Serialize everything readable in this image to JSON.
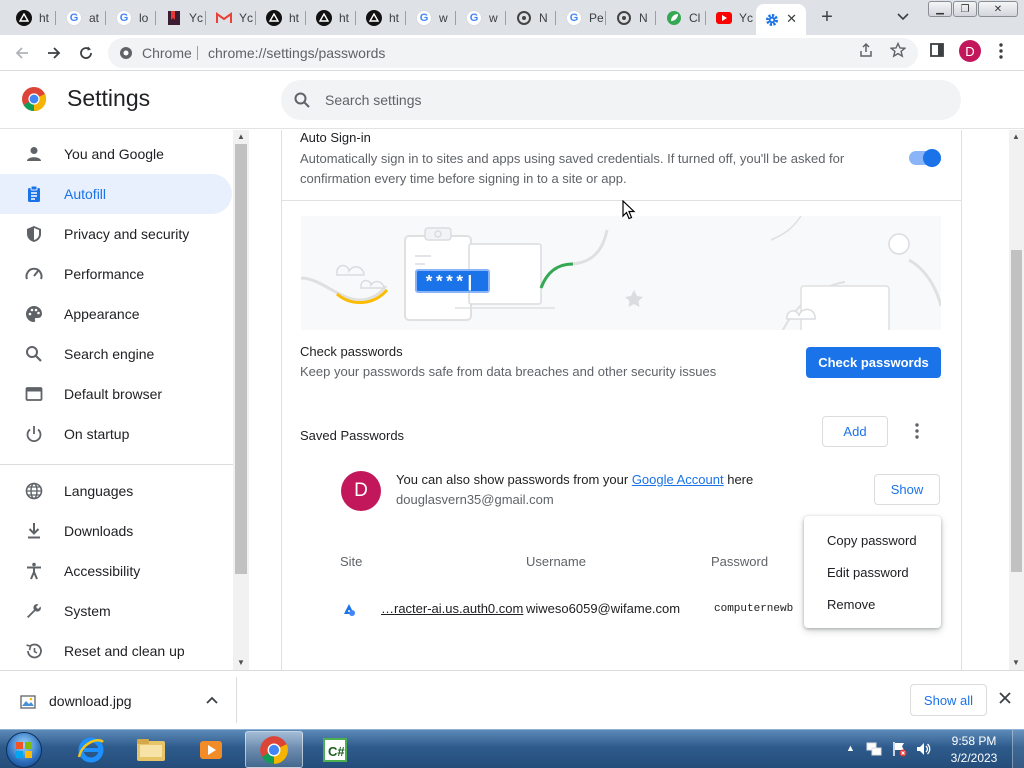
{
  "browser": {
    "tabs": [
      {
        "title": "ht",
        "icon": "github-icon"
      },
      {
        "title": "at",
        "icon": "google-icon"
      },
      {
        "title": "lo",
        "icon": "google-icon"
      },
      {
        "title": "Yc",
        "icon": "bookmark-icon"
      },
      {
        "title": "Yc",
        "icon": "gmail-icon"
      },
      {
        "title": "ht",
        "icon": "github-icon"
      },
      {
        "title": "ht",
        "icon": "github-icon"
      },
      {
        "title": "ht",
        "icon": "github-icon"
      },
      {
        "title": "w",
        "icon": "google-icon"
      },
      {
        "title": "w",
        "icon": "google-icon"
      },
      {
        "title": "N",
        "icon": "openai-icon"
      },
      {
        "title": "Pe",
        "icon": "google-icon"
      },
      {
        "title": "N",
        "icon": "openai-icon"
      },
      {
        "title": "Cl",
        "icon": "leaf-icon"
      },
      {
        "title": "Yc",
        "icon": "youtube-icon"
      },
      {
        "title": "",
        "icon": "settings-gear-icon"
      }
    ],
    "omnibox": {
      "site_label": "Chrome",
      "url": "chrome://settings/passwords"
    },
    "profile_initial": "D"
  },
  "settings": {
    "title": "Settings",
    "search_placeholder": "Search settings",
    "sidebar": [
      {
        "label": "You and Google",
        "icon": "person-icon"
      },
      {
        "label": "Autofill",
        "icon": "clipboard-icon",
        "active": true
      },
      {
        "label": "Privacy and security",
        "icon": "shield-icon"
      },
      {
        "label": "Performance",
        "icon": "speedometer-icon"
      },
      {
        "label": "Appearance",
        "icon": "palette-icon"
      },
      {
        "label": "Search engine",
        "icon": "search-icon"
      },
      {
        "label": "Default browser",
        "icon": "browser-window-icon"
      },
      {
        "label": "On startup",
        "icon": "power-icon"
      },
      {
        "label": "Languages",
        "icon": "globe-icon"
      },
      {
        "label": "Downloads",
        "icon": "download-icon"
      },
      {
        "label": "Accessibility",
        "icon": "accessibility-icon"
      },
      {
        "label": "System",
        "icon": "wrench-icon"
      },
      {
        "label": "Reset and clean up",
        "icon": "restore-icon"
      }
    ],
    "auto_signin": {
      "title": "Auto Sign-in",
      "description": "Automatically sign in to sites and apps using saved credentials. If turned off, you'll be asked for confirmation every time before signing in to a site or app.",
      "enabled": true
    },
    "banner_password_mask": "****|",
    "check_passwords": {
      "title": "Check passwords",
      "description": "Keep your passwords safe from data breaches and other security issues",
      "button": "Check passwords"
    },
    "saved_passwords": {
      "title": "Saved Passwords",
      "add_button": "Add",
      "account": {
        "avatar_initial": "D",
        "text_before": "You can also show passwords from your ",
        "link_text": "Google Account",
        "text_after": " here",
        "email": "douglasvern35@gmail.com",
        "show_button": "Show"
      },
      "columns": [
        "Site",
        "Username",
        "Password"
      ],
      "rows": [
        {
          "site": "…racter-ai.us.auth0.com",
          "username": "wiweso6059@wifame.com",
          "password": "computernewb"
        }
      ]
    },
    "context_menu": [
      "Copy password",
      "Edit password",
      "Remove"
    ]
  },
  "download_bar": {
    "file": "download.jpg",
    "show_all": "Show all"
  },
  "taskbar": {
    "time": "9:58 PM",
    "date": "3/2/2023"
  },
  "colors": {
    "accent": "#1a73e8",
    "active_bg": "#e8f0fe",
    "avatar": "#c2185b"
  }
}
